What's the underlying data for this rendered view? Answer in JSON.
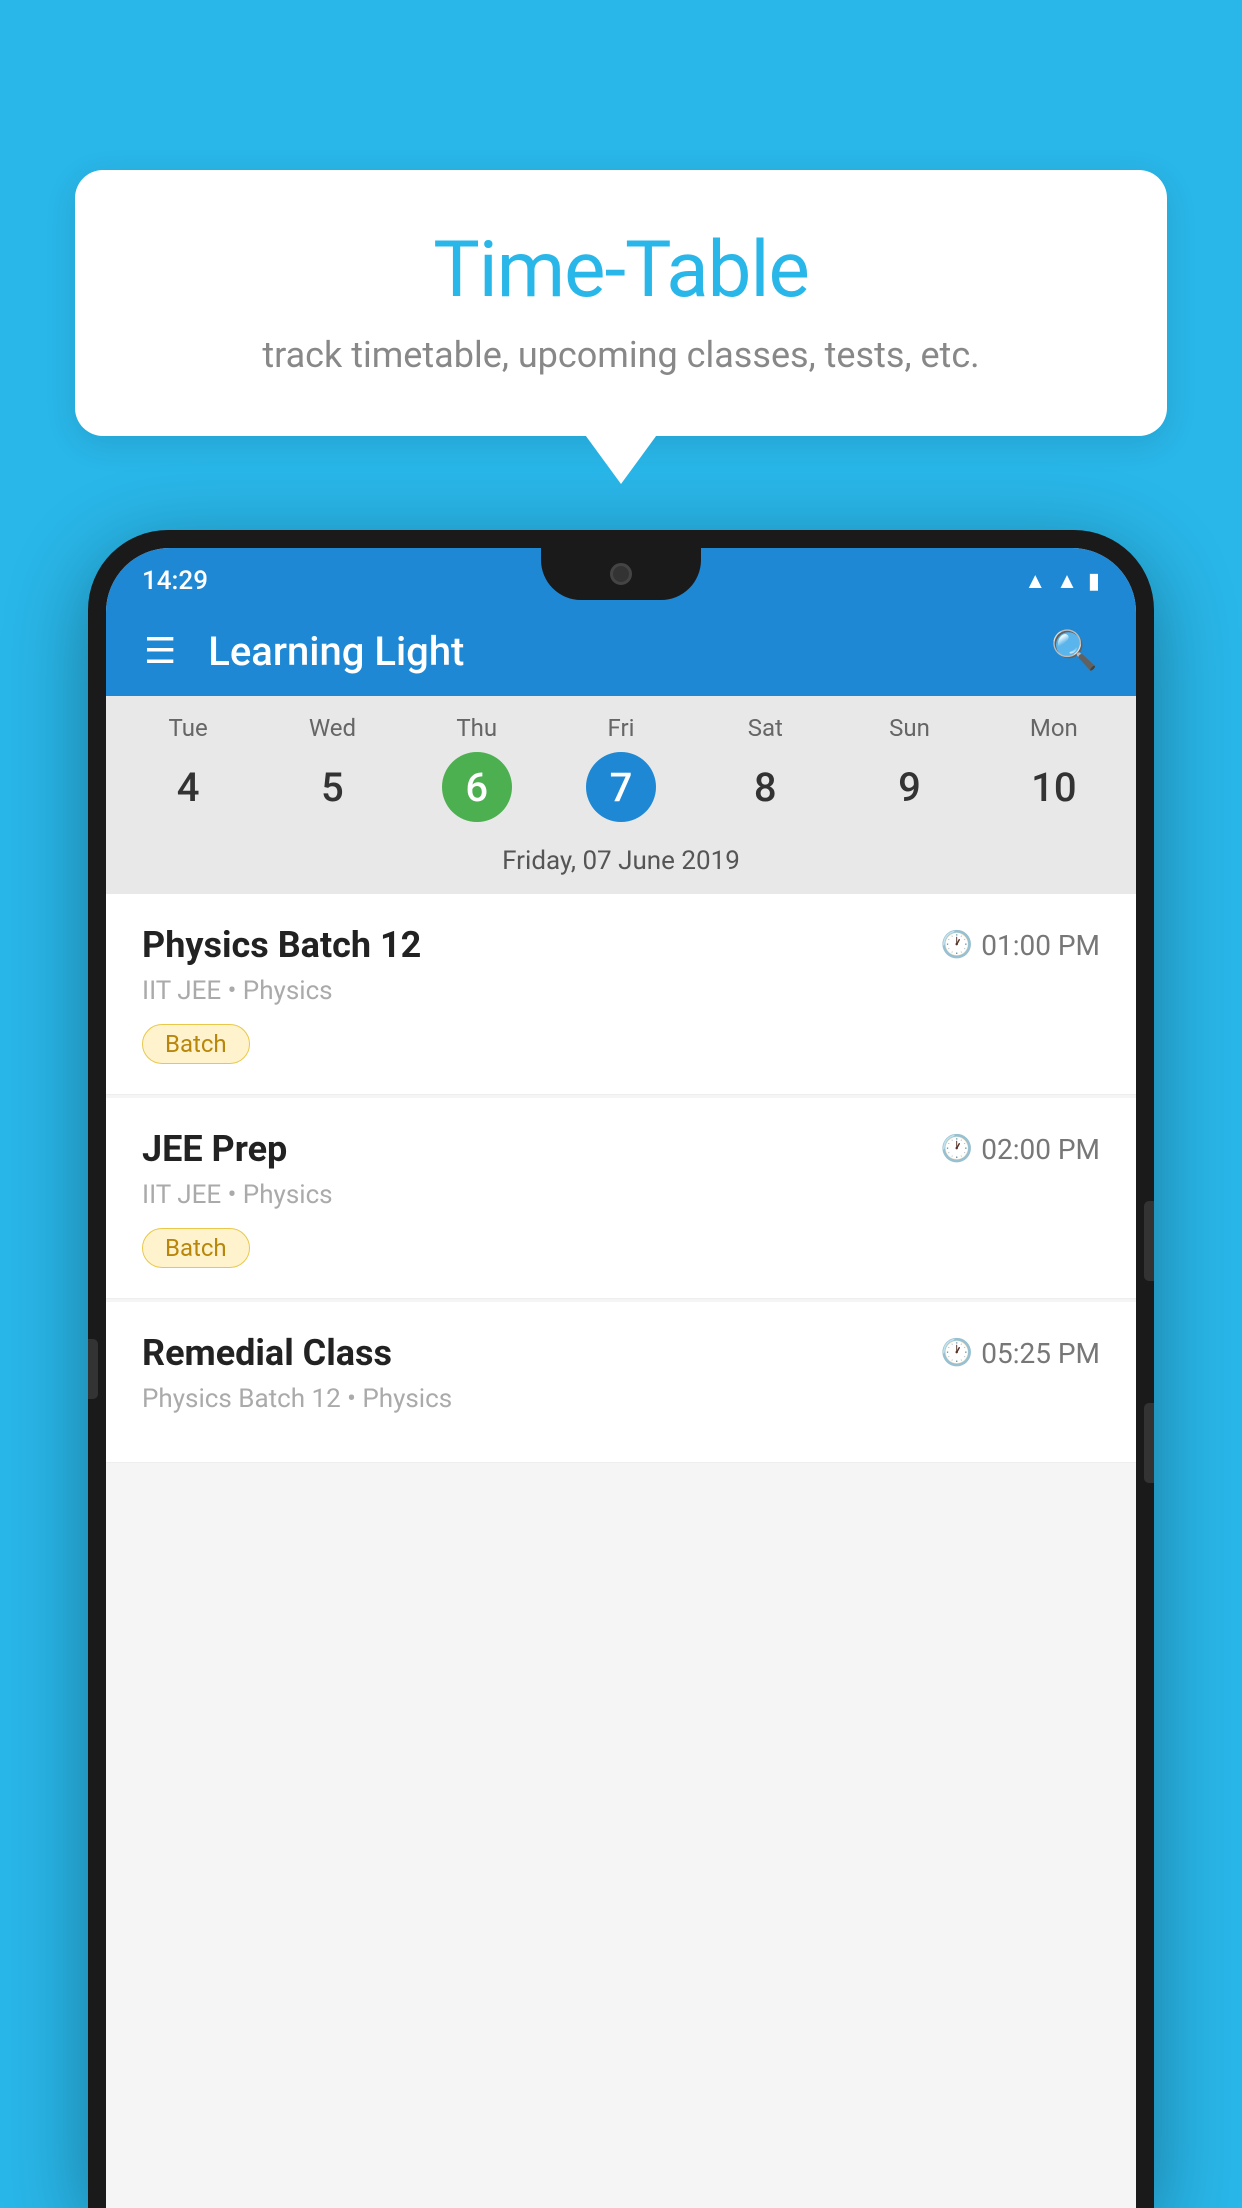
{
  "background_color": "#29b6e8",
  "speech_bubble": {
    "title": "Time-Table",
    "subtitle": "track timetable, upcoming classes, tests, etc."
  },
  "phone": {
    "status_bar": {
      "time": "14:29",
      "icons": [
        "wifi",
        "signal",
        "battery"
      ]
    },
    "app_bar": {
      "title": "Learning Light",
      "menu_icon": "☰",
      "search_icon": "🔍"
    },
    "calendar": {
      "days": [
        {
          "label": "Tue",
          "number": "4",
          "state": "normal"
        },
        {
          "label": "Wed",
          "number": "5",
          "state": "normal"
        },
        {
          "label": "Thu",
          "number": "6",
          "state": "today"
        },
        {
          "label": "Fri",
          "number": "7",
          "state": "selected"
        },
        {
          "label": "Sat",
          "number": "8",
          "state": "normal"
        },
        {
          "label": "Sun",
          "number": "9",
          "state": "normal"
        },
        {
          "label": "Mon",
          "number": "10",
          "state": "normal"
        }
      ],
      "selected_date_label": "Friday, 07 June 2019"
    },
    "schedule": [
      {
        "title": "Physics Batch 12",
        "time": "01:00 PM",
        "subtitle": "IIT JEE • Physics",
        "badge": "Batch"
      },
      {
        "title": "JEE Prep",
        "time": "02:00 PM",
        "subtitle": "IIT JEE • Physics",
        "badge": "Batch"
      },
      {
        "title": "Remedial Class",
        "time": "05:25 PM",
        "subtitle": "Physics Batch 12 • Physics",
        "badge": null
      }
    ]
  }
}
